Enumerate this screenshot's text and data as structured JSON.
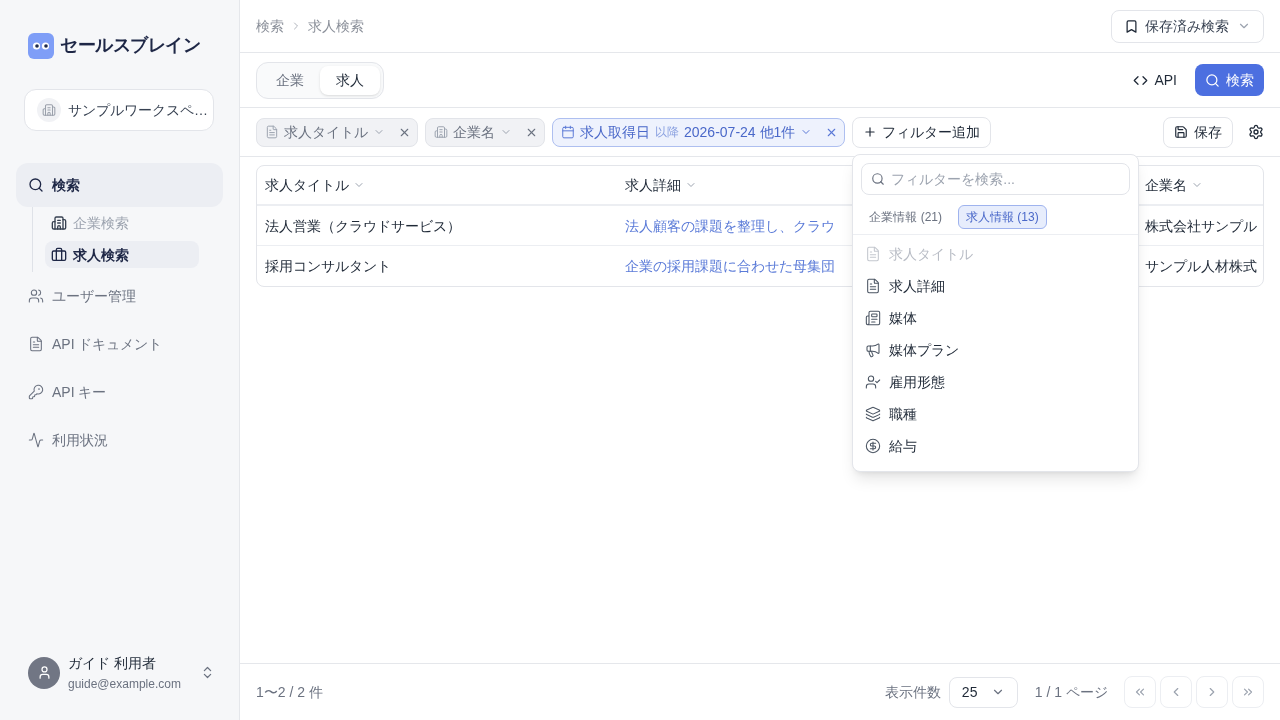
{
  "app": {
    "logo_text": "セールスブレイン"
  },
  "workspace": {
    "name": "サンプルワークスペ…"
  },
  "sidebar": {
    "items": [
      {
        "label": "検索",
        "selected": true,
        "children": [
          {
            "label": "企業検索",
            "selected": false
          },
          {
            "label": "求人検索",
            "selected": true
          }
        ]
      },
      {
        "label": "ユーザー管理",
        "selected": false
      },
      {
        "label": "API ドキュメント",
        "selected": false
      },
      {
        "label": "API キー",
        "selected": false
      },
      {
        "label": "利用状況",
        "selected": false
      }
    ]
  },
  "user": {
    "name": "ガイド 利用者",
    "email": "guide@example.com"
  },
  "breadcrumb": [
    "検索",
    "求人検索"
  ],
  "saved_searches_button": "保存済み検索",
  "tabs": [
    {
      "label": "企業",
      "selected": false
    },
    {
      "label": "求人",
      "selected": true
    }
  ],
  "actions": {
    "api": "API",
    "search": "検索"
  },
  "filters": [
    {
      "label": "求人タイトル",
      "active": false
    },
    {
      "label": "企業名",
      "active": false
    },
    {
      "label": "求人取得日",
      "operator": "以降",
      "value": "2026-07-24 他1件",
      "active": true
    }
  ],
  "add_filter": "フィルター追加",
  "save": "保存",
  "filter_menu": {
    "search": {
      "placeholder": "フィルターを検索..."
    },
    "tabs": [
      {
        "label": "企業情報 (21)",
        "selected": false
      },
      {
        "label": "求人情報 (13)",
        "selected": true
      }
    ],
    "items": [
      {
        "label": "求人タイトル",
        "disabled": true
      },
      {
        "label": "求人詳細",
        "disabled": false
      },
      {
        "label": "媒体",
        "disabled": false
      },
      {
        "label": "媒体プラン",
        "disabled": false
      },
      {
        "label": "雇用形態",
        "disabled": false
      },
      {
        "label": "職種",
        "disabled": false
      },
      {
        "label": "給与",
        "disabled": false
      }
    ]
  },
  "table": {
    "columns": [
      {
        "label": "求人タイトル"
      },
      {
        "label": "求人詳細"
      },
      {
        "label": "企業名"
      }
    ],
    "rows": [
      [
        "法人営業（クラウドサービス）",
        "法人顧客の課題を整理し、クラウ",
        "株式会社サンプル"
      ],
      [
        "採用コンサルタント",
        "企業の採用課題に合わせた母集団",
        "サンプル人材株式"
      ]
    ]
  },
  "footer": {
    "range": "1〜2 / 2 件",
    "page_size_label": "表示件数",
    "page_size": "25",
    "page_info": "1 / 1 ページ"
  },
  "pagination": [
    {
      "kind": "first",
      "disabled": true
    },
    {
      "kind": "prev",
      "disabled": true
    },
    {
      "kind": "next",
      "disabled": true
    },
    {
      "kind": "last",
      "disabled": true
    }
  ]
}
